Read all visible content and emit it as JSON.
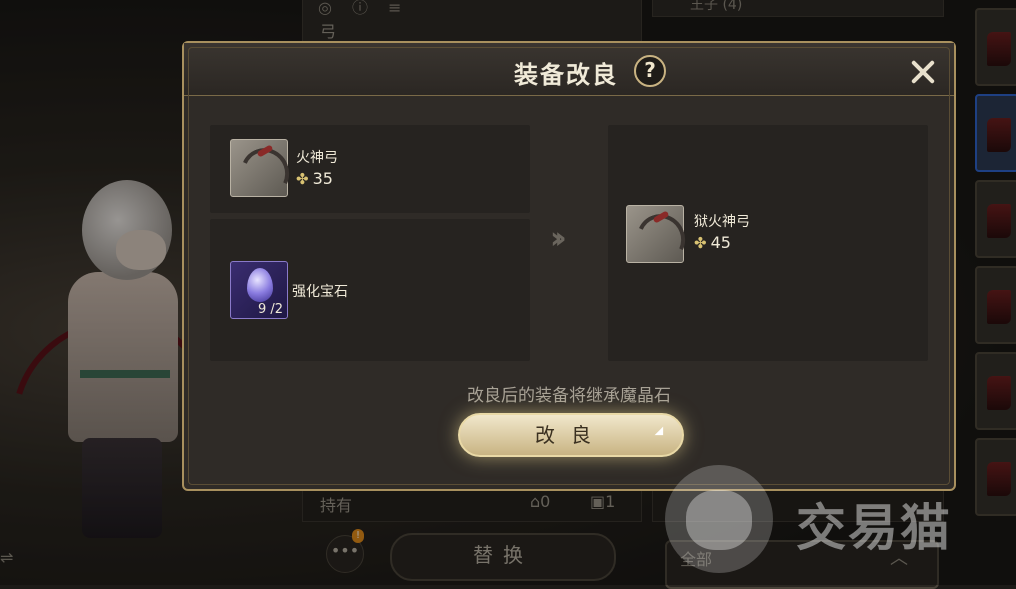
{
  "background": {
    "top_panel_label": "弓",
    "right_top_label": "王子 (4)",
    "hold_label": "持有",
    "count_warehouse": "0",
    "count_bag": "1",
    "more_badge": "!",
    "replace_button": "替换",
    "right_bottom_label": "全部"
  },
  "modal": {
    "title": "装备改良",
    "help": "?",
    "source_item": {
      "name": "火神弓",
      "level": "35"
    },
    "material_item": {
      "name": "强化宝石",
      "count": "9 /2"
    },
    "result_item": {
      "name": "狱火神弓",
      "level": "45"
    },
    "note": "改良后的装备将继承魔晶石",
    "improve_button": "改良"
  },
  "watermark": {
    "text": "交易猫"
  }
}
